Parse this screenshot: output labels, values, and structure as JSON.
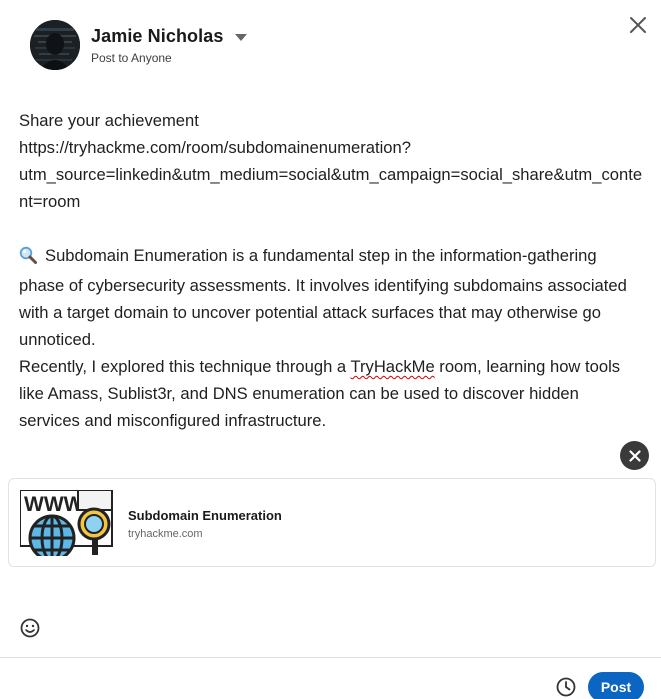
{
  "header": {
    "author_name": "Jamie Nicholas",
    "visibility": "Post to Anyone",
    "icons": {
      "close": "close-icon",
      "caret": "chevron-down-icon",
      "avatar": "avatar"
    }
  },
  "post": {
    "line1": "Share your achievement",
    "link_text": "https://tryhackme.com/room/subdomainenumeration?utm_source=linkedin&utm_medium=social&utm_campaign=social_share&utm_content=room",
    "para1": "Subdomain Enumeration is a fundamental step in the information-gathering phase of cybersecurity assessments. It involves identifying subdomains associated with a target domain to uncover potential attack surfaces that may otherwise go unnoticed.",
    "para2_a": "Recently, I explored this technique through a ",
    "para2_brand": "TryHackMe",
    "para2_b": " room, learning how tools like Amass, Sublist3r, and DNS enumeration can be used to discover hidden services and misconfigured infrastructure.",
    "emoji_icon": "magnifying-glass-icon"
  },
  "preview": {
    "title": "Subdomain Enumeration",
    "domain": "tryhackme.com",
    "thumb_text": "WWW"
  },
  "footer": {
    "post_label": "Post",
    "emoji_icon": "smiley-icon",
    "schedule_icon": "clock-icon"
  },
  "colors": {
    "accent": "#0a66c2",
    "text": "#1f1f1f",
    "muted": "#666666",
    "dismiss_bg": "#3a3a3a"
  }
}
